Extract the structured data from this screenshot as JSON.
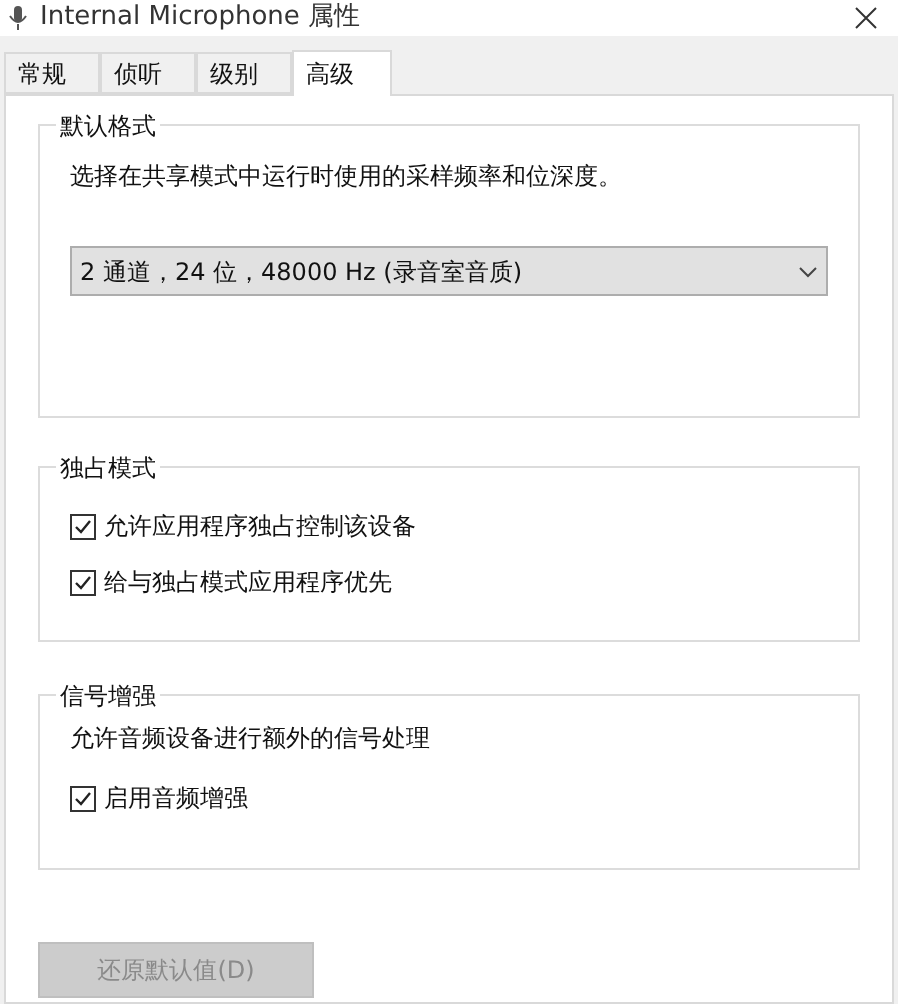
{
  "window": {
    "title": "Internal Microphone 属性"
  },
  "tabs": [
    {
      "label": "常规",
      "selected": false
    },
    {
      "label": "侦听",
      "selected": false
    },
    {
      "label": "级别",
      "selected": false
    },
    {
      "label": "高级",
      "selected": true
    }
  ],
  "default_format": {
    "title": "默认格式",
    "description": "选择在共享模式中运行时使用的采样频率和位深度。",
    "dropdown": {
      "value": "2 通道，24 位，48000 Hz (录音室音质)"
    }
  },
  "exclusive_mode": {
    "title": "独占模式",
    "options": [
      {
        "label": "允许应用程序独占控制该设备",
        "checked": true
      },
      {
        "label": "给与独占模式应用程序优先",
        "checked": true
      }
    ]
  },
  "signal_enhancement": {
    "title": "信号增强",
    "description": "允许音频设备进行额外的信号处理",
    "options": [
      {
        "label": "启用音频增强",
        "checked": true
      }
    ]
  },
  "restore_button": {
    "label": "还原默认值(D)",
    "disabled": true
  }
}
